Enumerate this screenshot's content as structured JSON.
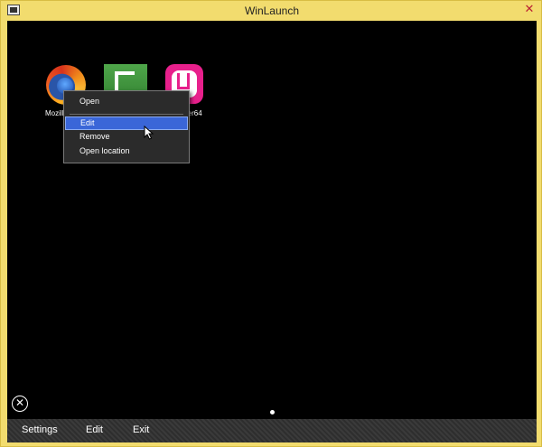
{
  "window": {
    "title": "WinLaunch",
    "close_label": "✕"
  },
  "desktop": {
    "icons": [
      {
        "label": "Mozilla",
        "icon": "firefox-icon"
      },
      {
        "label": "",
        "icon": "camtasia-icon"
      },
      {
        "label": "rver64",
        "icon": "wamp-icon"
      }
    ]
  },
  "context_menu": {
    "items": [
      {
        "label": "Open",
        "highlighted": false
      },
      {
        "label": "Edit",
        "highlighted": true
      },
      {
        "label": "Remove",
        "highlighted": false
      },
      {
        "label": "Open location",
        "highlighted": false
      }
    ]
  },
  "close_circle_glyph": "✕",
  "bottom_bar": {
    "settings_label": "Settings",
    "edit_label": "Edit",
    "exit_label": "Exit"
  },
  "colors": {
    "frame": "#f2dc6e",
    "highlight": "#3a66d8",
    "background": "#000000"
  }
}
